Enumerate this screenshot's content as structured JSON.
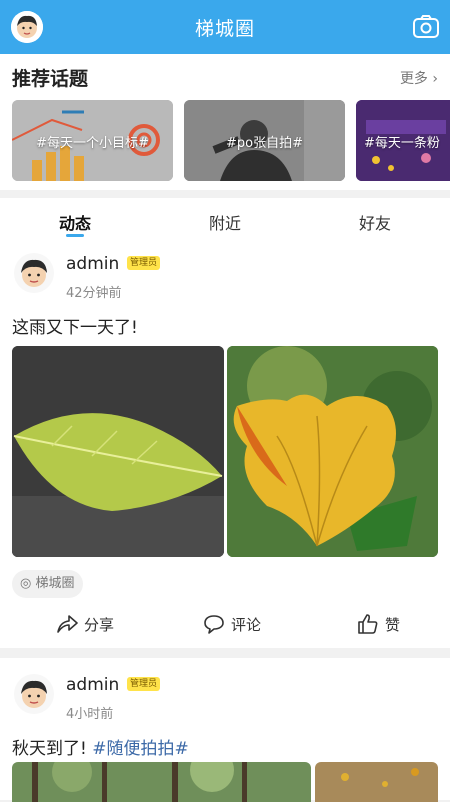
{
  "header": {
    "title": "梯城圈"
  },
  "topics": {
    "heading": "推荐话题",
    "more": "更多",
    "cards": [
      {
        "label": "#每天一个小目标#"
      },
      {
        "label": "#po张自拍#"
      },
      {
        "label": "#每天一条粉"
      }
    ]
  },
  "tabs": [
    {
      "label": "动态"
    },
    {
      "label": "附近"
    },
    {
      "label": "好友"
    }
  ],
  "posts": [
    {
      "username": "admin",
      "badge": "管理员",
      "time": "42分钟前",
      "text": "这雨又下一天了!",
      "circle": "梯城圈",
      "actions": {
        "share": "分享",
        "comment": "评论",
        "like": "赞"
      }
    },
    {
      "username": "admin",
      "badge": "管理员",
      "time": "4小时前",
      "text": "秋天到了!",
      "hashtag": "#随便拍拍#"
    }
  ]
}
